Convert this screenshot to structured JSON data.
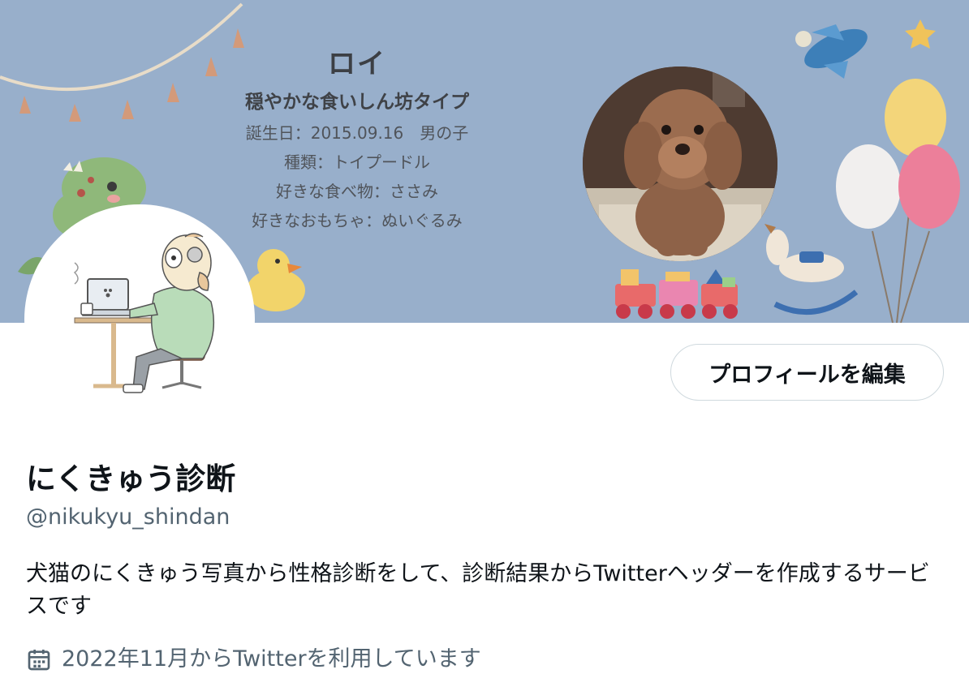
{
  "banner": {
    "pet_name": "ロイ",
    "personality_type": "穏やかな食いしん坊タイプ",
    "birthday_line": "誕生日：2015.09.16　男の子",
    "breed_line": "種類：トイプードル",
    "favorite_food_line": "好きな食べ物：ささみ",
    "favorite_toy_line": "好きなおもちゃ：ぬいぐるみ",
    "background_color": "#98afcb"
  },
  "profile": {
    "display_name": "にくきゅう診断",
    "handle": "@nikukyu_shindan",
    "bio": "犬猫のにくきゅう写真から性格診断をして、診断結果からTwitterヘッダーを作成するサービスです",
    "joined": "2022年11月からTwitterを利用しています",
    "joined_icon": "calendar-icon"
  },
  "actions": {
    "edit_profile_label": "プロフィールを編集"
  }
}
